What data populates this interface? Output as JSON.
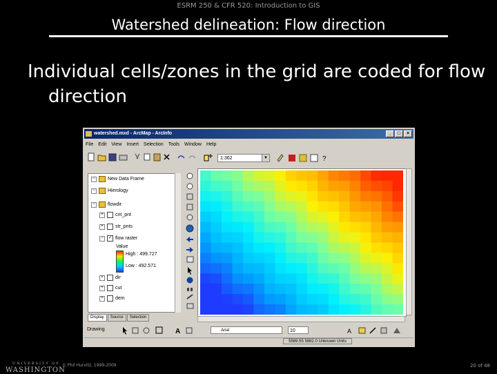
{
  "slide": {
    "course": "ESRM 250 & CFR 520: Introduction to GIS",
    "title": "Watershed delineation: Flow direction",
    "body": "Individual cells/zones in the grid are coded for flow direction",
    "footer_copyright": "© Phil Hurvitz, 1999-2009",
    "footer_page": "20 of 48",
    "logo_line1": "UNIVERSITY OF",
    "logo_line2": "WASHINGTON"
  },
  "window": {
    "title": "watershed.mxd - ArcMap - ArcInfo",
    "controls": [
      "_",
      "□",
      "×"
    ],
    "menus": [
      "File",
      "Edit",
      "View",
      "Insert",
      "Selection",
      "Tools",
      "Window",
      "Help"
    ],
    "scale_value": "1:362",
    "toc": [
      {
        "label": "New Data Frame",
        "type": "frame"
      },
      {
        "label": "Hierology",
        "type": "frame"
      },
      {
        "label": "flowdir",
        "type": "frame"
      },
      {
        "label": "cnt_pnt",
        "type": "layer",
        "checked": false
      },
      {
        "label": "str_pnts",
        "type": "layer",
        "checked": false
      },
      {
        "label": "flow raster",
        "type": "layer",
        "checked": true
      },
      {
        "label": "Value",
        "type": "legend"
      },
      {
        "label": "High : 499.727",
        "type": "legend"
      },
      {
        "label": "Low : 492.571",
        "type": "legend"
      },
      {
        "label": "dir",
        "type": "layer",
        "checked": false
      },
      {
        "label": "cut",
        "type": "layer",
        "checked": false
      },
      {
        "label": "dem",
        "type": "layer",
        "checked": false
      }
    ],
    "tabs": [
      "Display",
      "Source",
      "Selection"
    ],
    "drawing_label": "Drawing",
    "font_name": "Arial",
    "font_size": "10",
    "status_coords": "5589.55  5882.0 Unknown Units"
  },
  "colors": {
    "title_bar": "#0a246a",
    "ramp_low": "#1e3cff",
    "ramp_high": "#ff2a00"
  }
}
